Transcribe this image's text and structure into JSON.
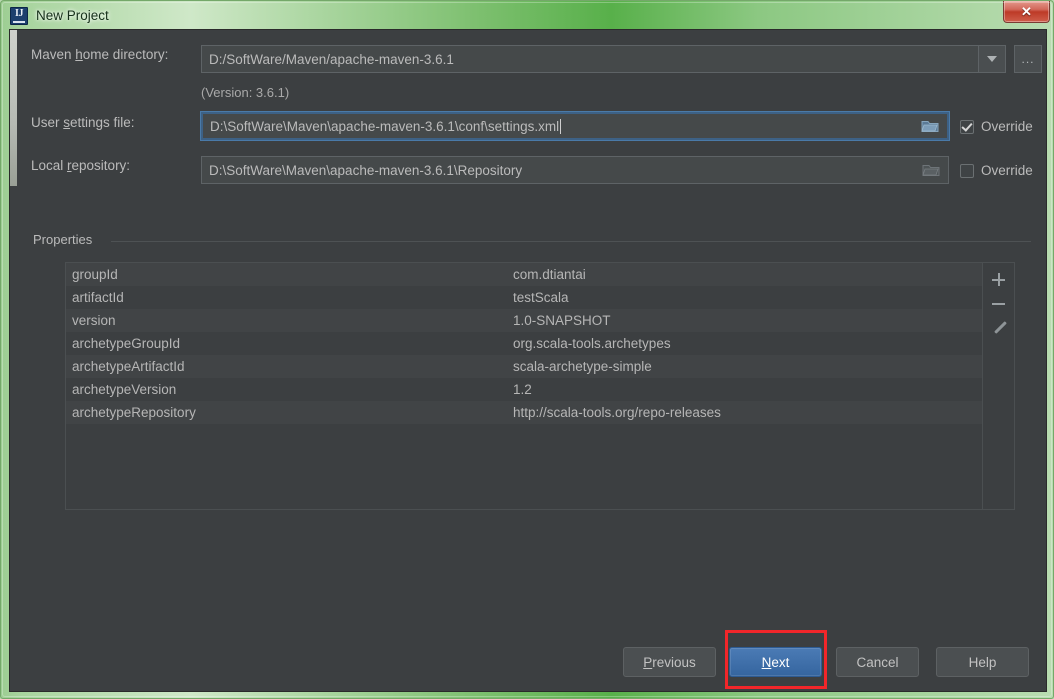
{
  "window": {
    "title": "New Project",
    "app_icon": "intellij-idea-icon",
    "close_label": "✕"
  },
  "form": {
    "maven_home": {
      "label_pre": "Maven ",
      "label_mnemonic": "h",
      "label_post": "ome directory:",
      "value": "D:/SoftWare/Maven/apache-maven-3.6.1",
      "browse_label": "...",
      "version_hint": "(Version: 3.6.1)"
    },
    "user_settings": {
      "label_pre": "User ",
      "label_mnemonic": "s",
      "label_post": "ettings file:",
      "value": "D:\\SoftWare\\Maven\\apache-maven-3.6.1\\conf\\settings.xml",
      "override_label": "Override",
      "override_checked": true
    },
    "local_repository": {
      "label_pre": "Local ",
      "label_mnemonic": "r",
      "label_post": "epository:",
      "value": "D:\\SoftWare\\Maven\\apache-maven-3.6.1\\Repository",
      "override_label": "Override",
      "override_checked": false
    }
  },
  "properties": {
    "group_title": "Properties",
    "rows": [
      {
        "key": "groupId",
        "value": "com.dtiantai"
      },
      {
        "key": "artifactId",
        "value": "testScala"
      },
      {
        "key": "version",
        "value": "1.0-SNAPSHOT"
      },
      {
        "key": "archetypeGroupId",
        "value": "org.scala-tools.archetypes"
      },
      {
        "key": "archetypeArtifactId",
        "value": "scala-archetype-simple"
      },
      {
        "key": "archetypeVersion",
        "value": "1.2"
      },
      {
        "key": "archetypeRepository",
        "value": "http://scala-tools.org/repo-releases"
      }
    ],
    "toolbar": {
      "add": "add-icon",
      "remove": "remove-icon",
      "edit": "edit-icon"
    }
  },
  "buttons": {
    "previous": {
      "pre": "",
      "mnemonic": "P",
      "post": "revious"
    },
    "next": {
      "pre": "",
      "mnemonic": "N",
      "post": "ext"
    },
    "cancel": {
      "label": "Cancel"
    },
    "help": {
      "label": "Help"
    }
  },
  "colors": {
    "dialog_bg": "#3c3f41",
    "field_bg": "#45494a",
    "accent_blue": "#35659f",
    "focus_border": "#3d6185",
    "highlight_red": "#f2262a",
    "frame_green": "#7ec070",
    "text": "#bbbbbb"
  }
}
